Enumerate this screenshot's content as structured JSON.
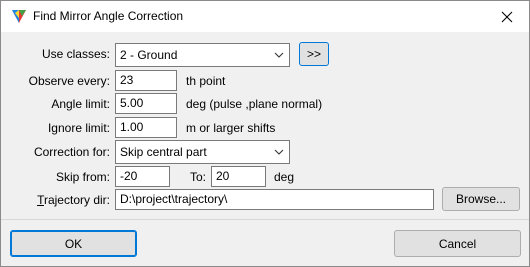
{
  "window": {
    "title": "Find Mirror Angle Correction",
    "close_symbol": "×"
  },
  "form": {
    "use_classes": {
      "label": "Use classes:",
      "value": "2 - Ground",
      "more_button": ">>"
    },
    "observe_every": {
      "label": "Observe every:",
      "value": "23",
      "unit": "th point"
    },
    "angle_limit": {
      "label": "Angle limit:",
      "value": "5.00",
      "unit": "deg (pulse ,plane normal)"
    },
    "ignore_limit": {
      "label": "Ignore limit:",
      "value": "1.00",
      "unit": "m or larger shifts"
    },
    "correction_for": {
      "label": "Correction for:",
      "value": "Skip central part"
    },
    "skip_from": {
      "label": "Skip from:",
      "from_value": "-20",
      "to_label": "To:",
      "to_value": "20",
      "unit": "deg"
    },
    "trajectory_dir": {
      "label_prefix": "T",
      "label_rest": "rajectory dir:",
      "value": "D:\\project\\trajectory\\",
      "browse_label": "Browse..."
    }
  },
  "footer": {
    "ok_label": "OK",
    "cancel_label": "Cancel"
  },
  "icons": {
    "app": "terrasolid-app-icon",
    "close": "close-icon",
    "dropdown": "chevron-down-icon"
  },
  "colors": {
    "titlebar_bg": "#ffffff",
    "dialog_bg": "#f0f0f0",
    "default_button_border": "#0078d7"
  }
}
